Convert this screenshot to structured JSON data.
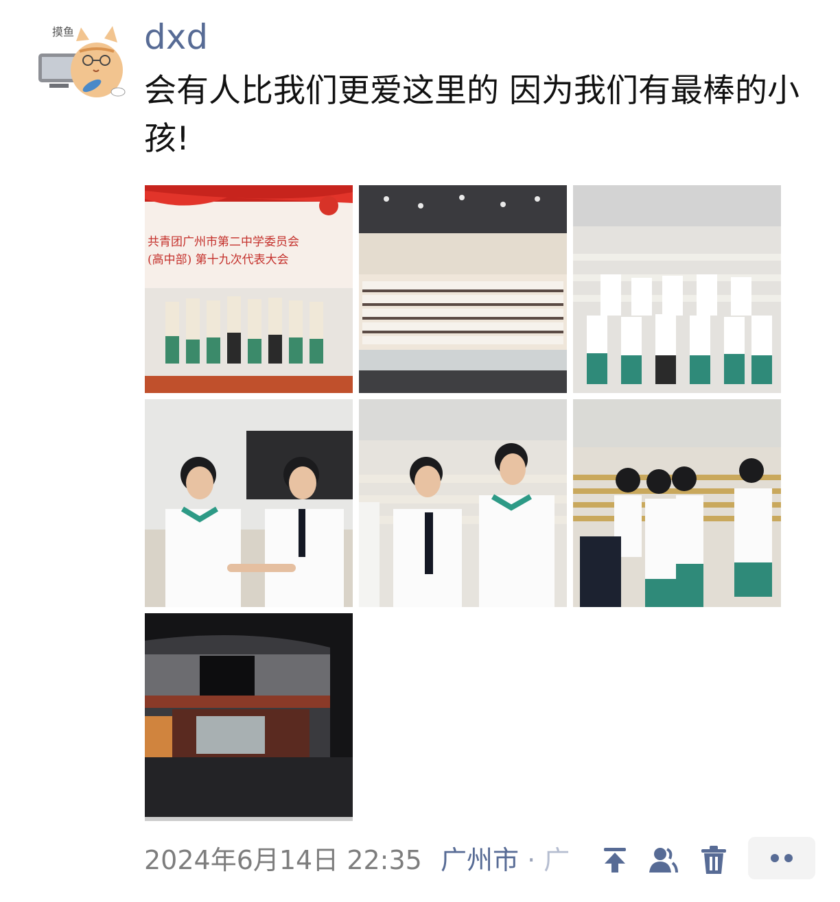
{
  "post": {
    "username": "dxd",
    "text": "会有人比我们更爱这里的 因为我们有最棒的小孩!",
    "avatar": {
      "icon": "cat-fishing-avatar-icon",
      "label": "摸鱼"
    }
  },
  "photos": [
    {
      "name": "photo-1",
      "icon": "group-photo-stage-banner",
      "banner": "共青团广州市第二中学委员会 (高中部) 第十九次代表大会"
    },
    {
      "name": "photo-2",
      "icon": "auditorium-group-photo"
    },
    {
      "name": "photo-3",
      "icon": "auditorium-group-photo-small"
    },
    {
      "name": "photo-4",
      "icon": "two-students-photo"
    },
    {
      "name": "photo-5",
      "icon": "three-students-photo"
    },
    {
      "name": "photo-6",
      "icon": "five-students-photo"
    },
    {
      "name": "photo-7",
      "icon": "building-night-photo"
    }
  ],
  "footer": {
    "timestamp": "2024年6月14日 22:35",
    "location": "广州市",
    "location_separator": "·",
    "location_truncated": "广",
    "icons": [
      "pin-top-icon",
      "visibility-people-icon",
      "delete-icon",
      "more-icon"
    ]
  },
  "colors": {
    "link": "#576b95",
    "meta": "#7d7d7d",
    "text": "#111111"
  }
}
